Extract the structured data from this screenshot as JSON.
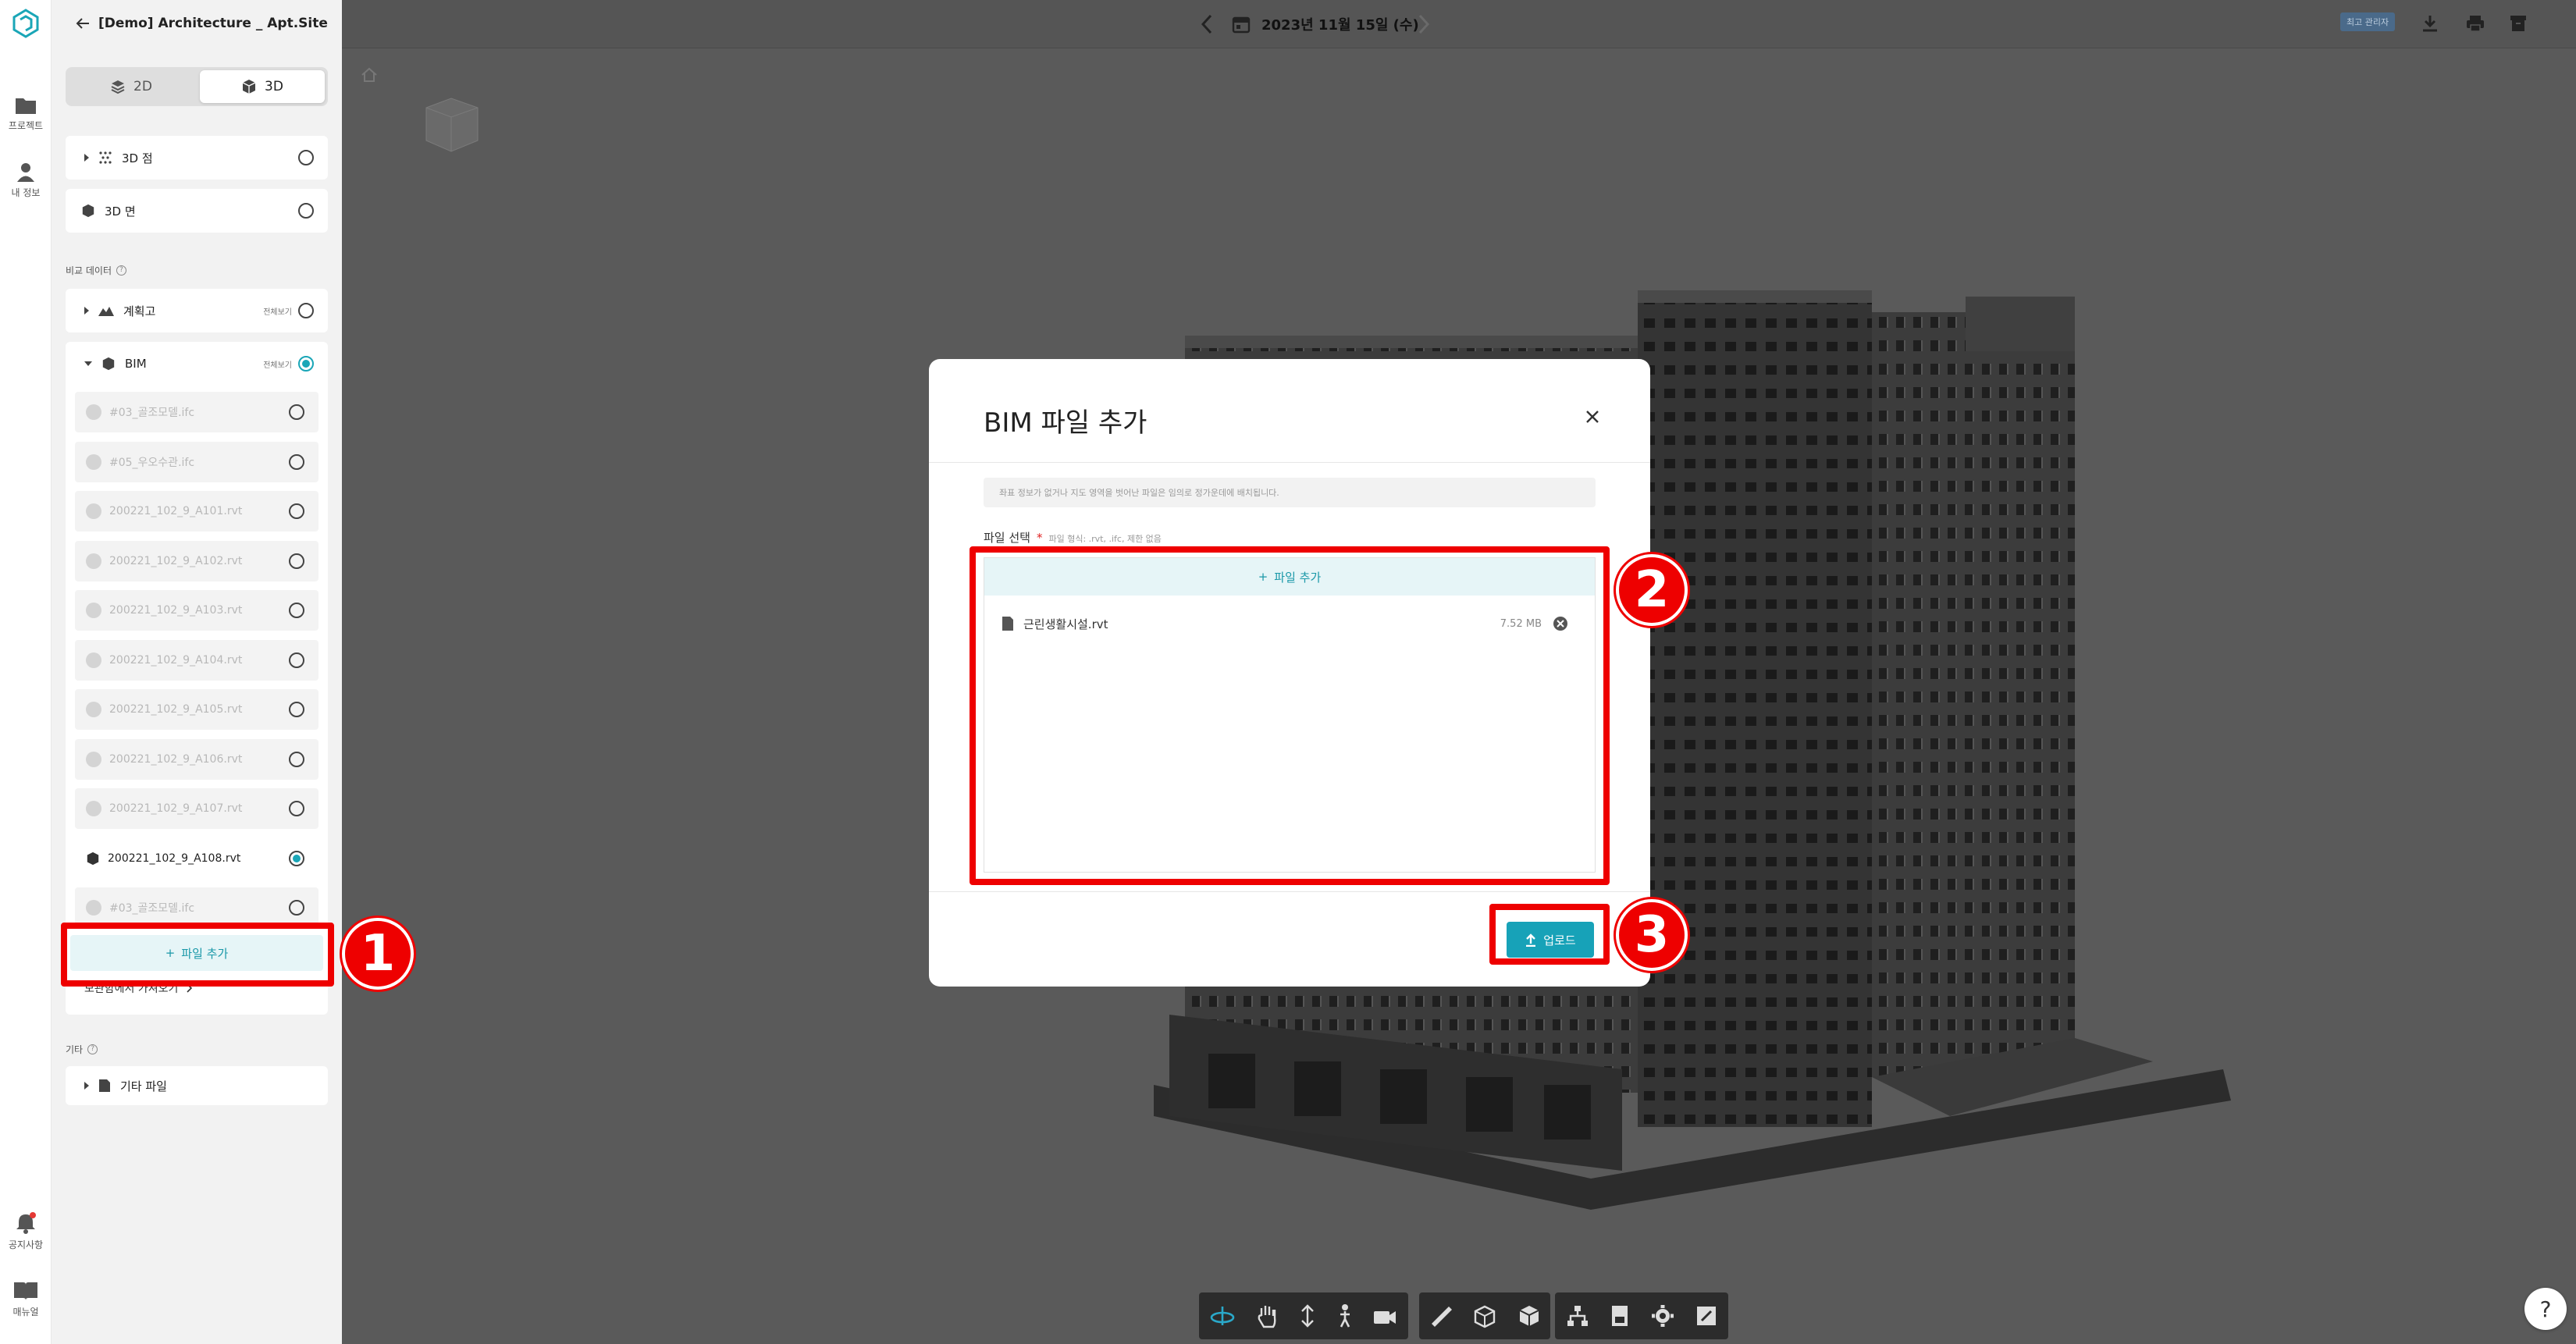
{
  "rail": {
    "items": [
      {
        "label": "프로젝트",
        "icon": "folder-icon"
      },
      {
        "label": "내 정보",
        "icon": "user-icon"
      },
      {
        "label": "공지사항",
        "icon": "bell-icon"
      },
      {
        "label": "매뉴얼",
        "icon": "book-icon"
      }
    ]
  },
  "sidebar": {
    "project_title": "[Demo] Architecture _ Apt.Site",
    "view_toggle": {
      "opt_2d": "2D",
      "opt_3d": "3D",
      "selected": "3D"
    },
    "layers": [
      {
        "label": "3D 점",
        "checked": false
      },
      {
        "label": "3D 면",
        "checked": false
      }
    ],
    "compare_label": "비교 데이터",
    "plan": {
      "label": "계획고",
      "show_all": "전체보기"
    },
    "bim": {
      "label": "BIM",
      "show_all": "전체보기",
      "files": [
        {
          "name": "#03_골조모델.ifc",
          "active": false
        },
        {
          "name": "#05_우오수관.ifc",
          "active": false
        },
        {
          "name": "200221_102_9_A101.rvt",
          "active": false
        },
        {
          "name": "200221_102_9_A102.rvt",
          "active": false
        },
        {
          "name": "200221_102_9_A103.rvt",
          "active": false
        },
        {
          "name": "200221_102_9_A104.rvt",
          "active": false
        },
        {
          "name": "200221_102_9_A105.rvt",
          "active": false
        },
        {
          "name": "200221_102_9_A106.rvt",
          "active": false
        },
        {
          "name": "200221_102_9_A107.rvt",
          "active": false
        },
        {
          "name": "200221_102_9_A108.rvt",
          "active": true
        },
        {
          "name": "#03_골조모델.ifc",
          "active": false
        }
      ],
      "add_file": "파일 추가",
      "import_from": "보관함에서 가져오기"
    },
    "other_label": "기타",
    "other_files": "기타 파일"
  },
  "viewer": {
    "date": "2023년 11월 15일 (수)",
    "latest_badge": "최고 관리자"
  },
  "modal": {
    "title": "BIM 파일 추가",
    "info": "좌표 정보가 없거나 지도 영역을 벗어난 파일은 임의로 정가운데에 배치됩니다.",
    "file_select_label": "파일 선택",
    "required_mark": "*",
    "format_hint": "파일 형식: .rvt, .ifc, 제한 없음",
    "add_file": "파일 추가",
    "file": {
      "name": "근린생활시설.rvt",
      "size": "7.52 MB"
    },
    "upload": "업로드"
  },
  "annotations": {
    "step1": "1",
    "step2": "2",
    "step3": "3"
  },
  "help": "?",
  "colors": {
    "accent": "#17a2b8",
    "highlight": "#ee0000",
    "viewer_bg": "#5a5a5a"
  }
}
